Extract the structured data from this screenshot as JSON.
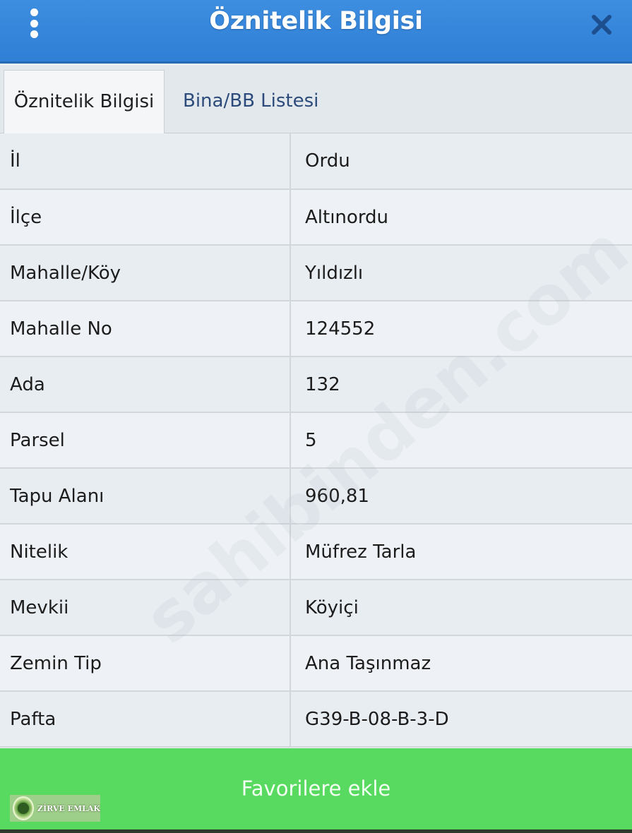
{
  "header": {
    "title": "Öznitelik Bilgisi",
    "menu_icon": "kebab-menu-icon",
    "close_icon": "close-icon"
  },
  "tabs": [
    {
      "label": "Öznitelik Bilgisi",
      "active": true
    },
    {
      "label": "Bina/BB Listesi",
      "active": false
    }
  ],
  "attributes": [
    {
      "key": "İl",
      "value": "Ordu"
    },
    {
      "key": "İlçe",
      "value": "Altınordu"
    },
    {
      "key": "Mahalle/Köy",
      "value": "Yıldızlı"
    },
    {
      "key": "Mahalle No",
      "value": "124552"
    },
    {
      "key": "Ada",
      "value": "132"
    },
    {
      "key": "Parsel",
      "value": "5"
    },
    {
      "key": "Tapu Alanı",
      "value": "960,81"
    },
    {
      "key": "Nitelik",
      "value": "Müfrez Tarla"
    },
    {
      "key": "Mevkii",
      "value": "Köyiçi"
    },
    {
      "key": "Zemin Tip",
      "value": "Ana Taşınmaz"
    },
    {
      "key": "Pafta",
      "value": "G39-B-08-B-3-D"
    }
  ],
  "favorite_button": {
    "label": "Favorilere ekle"
  },
  "watermarks": {
    "badge_text": "ZİRVE EMLAK",
    "background_text": "sahibinden.com"
  },
  "colors": {
    "header_blue": "#2f7fd6",
    "button_green": "#58d95f",
    "tab_link": "#2c4a7a"
  }
}
